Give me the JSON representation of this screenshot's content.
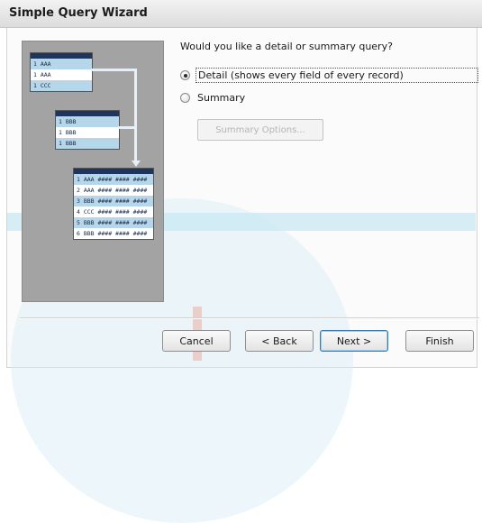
{
  "window": {
    "title": "Simple Query Wizard"
  },
  "illustration": {
    "top_table": [
      "1 AAA",
      "1 AAA",
      "1 CCC"
    ],
    "middle_table": [
      "1 BBB",
      "1 BBB",
      "1 BBB"
    ],
    "result_table": [
      "1 AAA  ####  ####  ####",
      "2 AAA  ####  ####  ####",
      "3 BBB  ####  ####  ####",
      "4 CCC  ####  ####  ####",
      "5 BBB  ####  ####  ####",
      "6 BBB  ####  ####  ####"
    ]
  },
  "question": "Would you like a detail or summary query?",
  "options": [
    {
      "label": "Detail (shows every field of every record)",
      "checked": true
    },
    {
      "label": "Summary",
      "checked": false
    }
  ],
  "summary_options_button": "Summary Options...",
  "buttons": {
    "cancel": "Cancel",
    "back": "< Back",
    "next": "Next >",
    "finish": "Finish"
  }
}
